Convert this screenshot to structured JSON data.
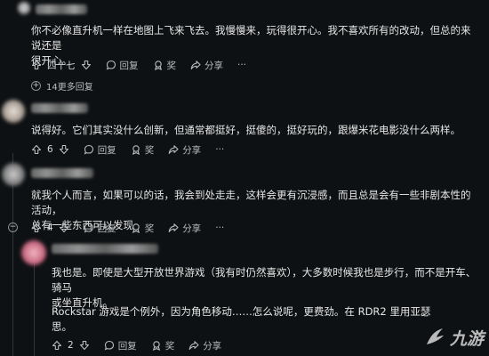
{
  "comments": [
    {
      "body_lines": [
        "你不必像直升机一样在地图上飞来飞去。我慢慢来，玩得很开心。我不喜欢所有的改动，但总的来说还是",
        "很开心。"
      ],
      "votes": "四十七",
      "reply_label": "回复",
      "award_label": "奖",
      "share_label": "分享",
      "more_replies": "14更多回复"
    },
    {
      "body_lines": [
        "说得好。它们其实没什么创新，但通常都挺好，挺傻的，挺好玩的，跟爆米花电影没什么两样。"
      ],
      "votes": "6",
      "reply_label": "回复",
      "award_label": "奖",
      "share_label": "分享"
    },
    {
      "body_lines": [
        "就我个人而言，如果可以的话，我会到处走走，这样会更有沉浸感，而且总是会有一些非剧本性的活动，",
        "总有一些东西可以发现"
      ],
      "votes": "4",
      "reply_label": "回复",
      "award_label": "奖",
      "share_label": "分享"
    },
    {
      "body_lines": [
        "我也是。即使是大型开放世界游戏（我有时仍然喜欢），大多数时候我也是步行，而不是开车、骑马",
        "或坐直升机。"
      ],
      "body2_lines": [
        "Rockstar 游戏是个例外，因为角色移动……怎么说呢，更费劲。在 RDR2 里用亚瑟",
        "思。"
      ],
      "votes": "2",
      "reply_label": "回复",
      "award_label": "奖",
      "share_label": "分享"
    }
  ],
  "watermark": {
    "text": "九游"
  },
  "colors": {
    "background": "#0e1113",
    "text": "#e6e6e6",
    "muted": "#b7bcbf",
    "thread_line": "#343536"
  }
}
